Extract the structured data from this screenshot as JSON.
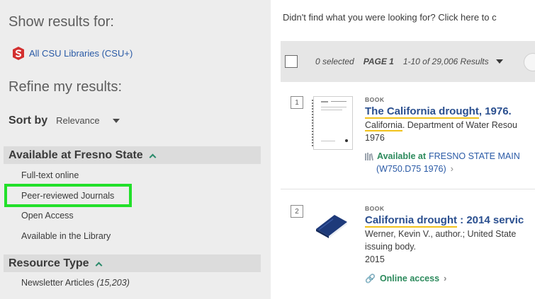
{
  "sidebar": {
    "show_results_heading": "Show results for:",
    "scope_link": "All CSU Libraries (CSU+)",
    "refine_heading": "Refine my results:",
    "sort_label": "Sort by",
    "sort_value": "Relevance",
    "facets": [
      {
        "heading": "Available at Fresno State",
        "items": [
          "Full-text online",
          "Peer-reviewed Journals",
          "Open Access",
          "Available in the Library"
        ]
      },
      {
        "heading": "Resource Type",
        "items": [
          {
            "label": "Newsletter Articles",
            "count": "(15,203)"
          }
        ]
      }
    ]
  },
  "main": {
    "didnt_find": "Didn't find what you were looking for? Click here to c",
    "toolbar": {
      "selected": "0 selected",
      "page": "PAGE 1",
      "results": "1-10 of 29,006 Results"
    },
    "results": [
      {
        "number": "1",
        "type": "BOOK",
        "title_hl": "The California drought",
        "title_rest": ", 1976.",
        "author_hl": "California",
        "author_rest": ". Department of Water Resou",
        "year": "1976",
        "avail_status": "Available at",
        "avail_location": "FRESNO STATE MAIN",
        "avail_callnumber": "(W750.D75 1976)"
      },
      {
        "number": "2",
        "type": "BOOK",
        "title_hl": "California drought",
        "title_rest": " : 2014 servic",
        "author_line": "Werner, Kevin V., author.; United State",
        "author_line2": "issuing body.",
        "year": "2015",
        "access": "Online access"
      }
    ]
  },
  "colors": {
    "highlight_box": "#22e02a",
    "link_blue": "#2a4f8f",
    "available_green": "#2c8a5c",
    "underline_yellow": "#f1c21b"
  }
}
